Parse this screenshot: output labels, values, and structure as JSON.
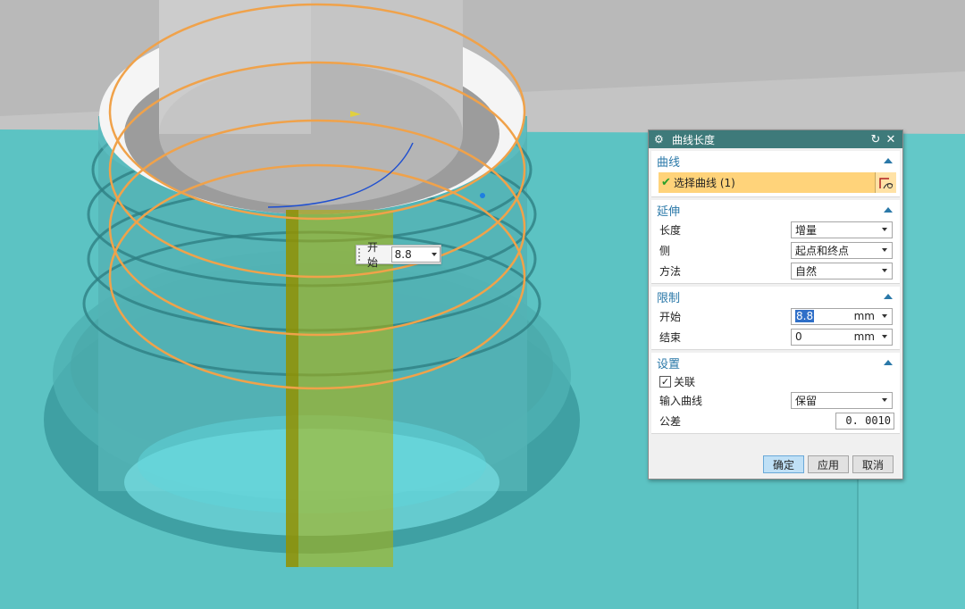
{
  "viewport": {
    "floating_input": {
      "label": "开始",
      "value": "8.8"
    }
  },
  "dialog": {
    "title": "曲线长度",
    "section_curve": {
      "title": "曲线",
      "select_curve_label": "选择曲线 (1)"
    },
    "section_extend": {
      "title": "延伸",
      "rows": [
        {
          "label": "长度",
          "value": "增量"
        },
        {
          "label": "侧",
          "value": "起点和终点"
        },
        {
          "label": "方法",
          "value": "自然"
        }
      ]
    },
    "section_limit": {
      "title": "限制",
      "start": {
        "label": "开始",
        "value": "8.8",
        "unit": "mm"
      },
      "end": {
        "label": "结束",
        "value": "0",
        "unit": "mm"
      }
    },
    "section_settings": {
      "title": "设置",
      "associative_label": "关联",
      "associative_checked": true,
      "input_curve": {
        "label": "输入曲线",
        "value": "保留"
      },
      "tolerance": {
        "label": "公差",
        "value": "0. 0010"
      }
    },
    "buttons": {
      "ok": "确定",
      "apply": "应用",
      "cancel": "取消"
    }
  },
  "colors": {
    "title_bar": "#3e7a7a",
    "section_title": "#2a78a8",
    "selection_highlight": "#ffd37a"
  }
}
